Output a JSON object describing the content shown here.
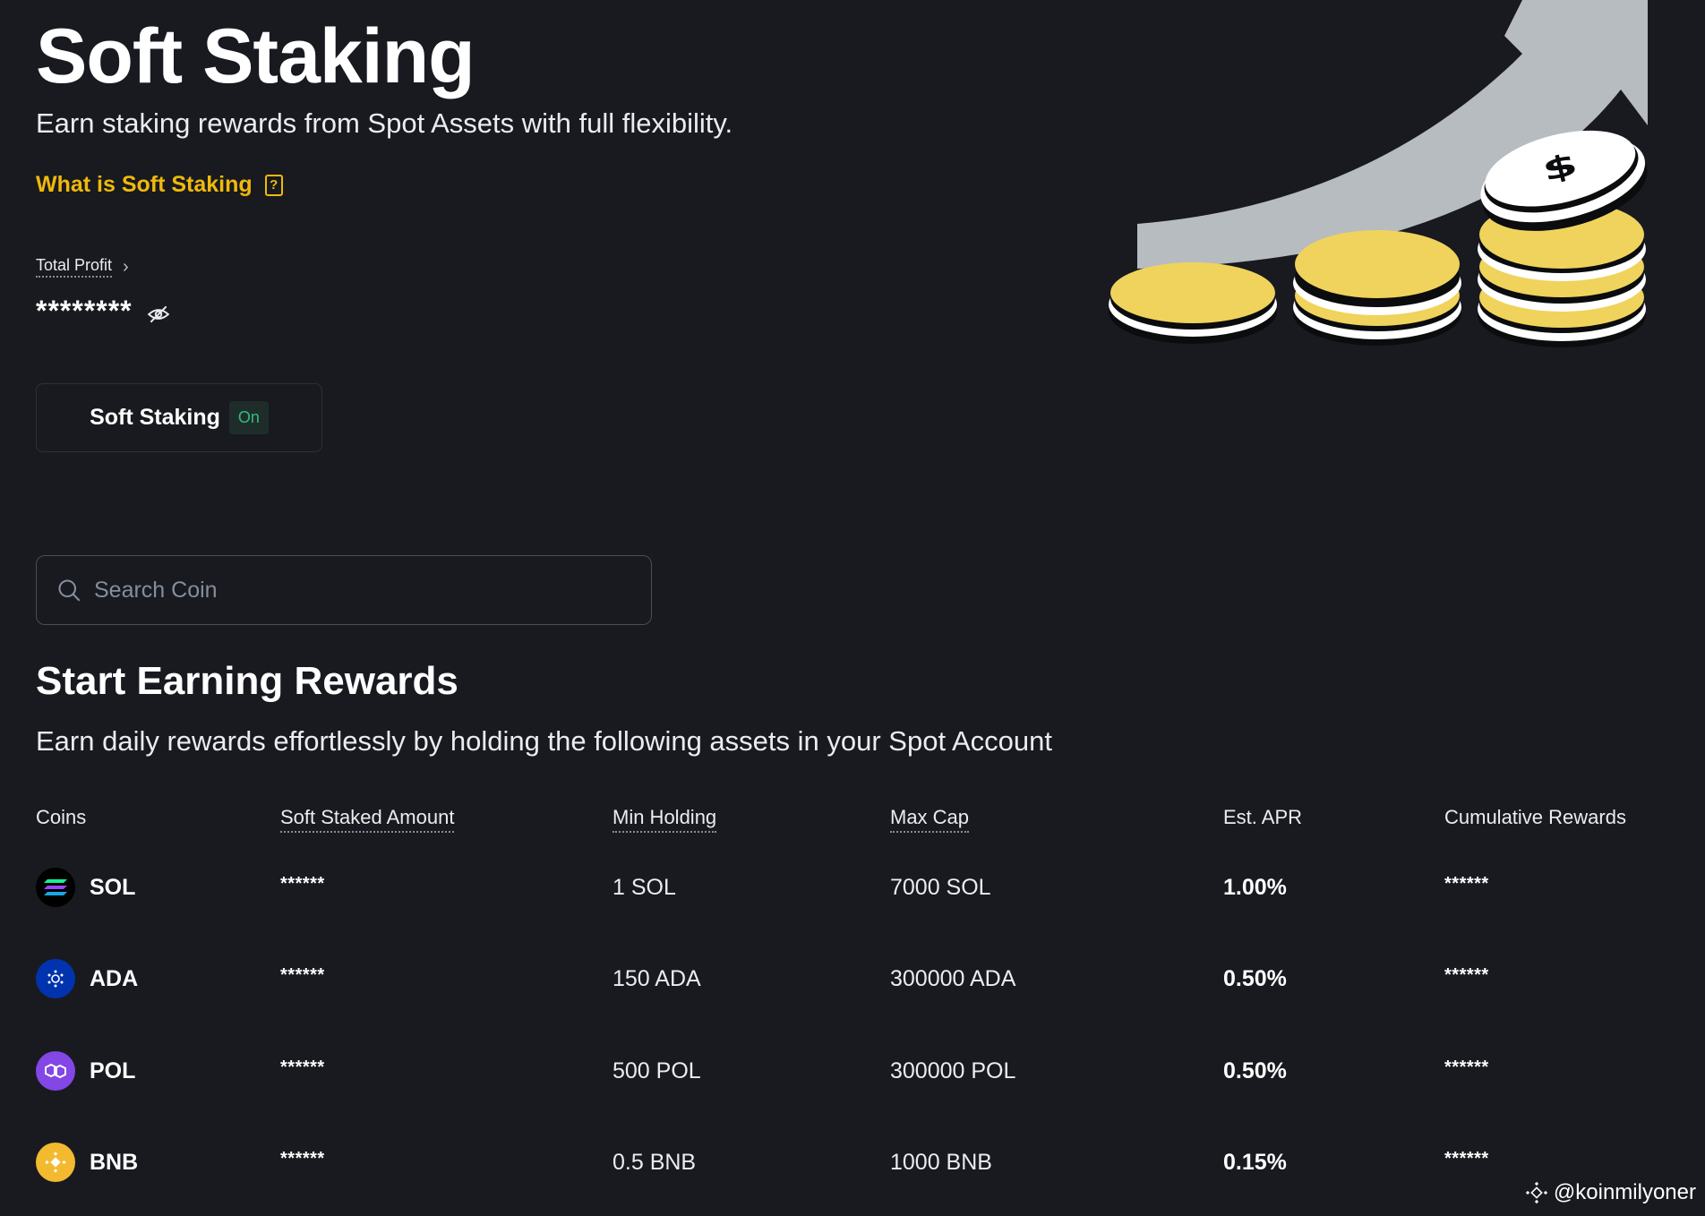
{
  "header": {
    "title": "Soft Staking",
    "subtitle": "Earn staking rewards from Spot Assets with full flexibility.",
    "help_link": "What is Soft Staking",
    "help_icon": "question-book-icon"
  },
  "profit": {
    "label": "Total Profit",
    "value": "********",
    "chevron_icon": "chevron-right-icon",
    "hide_icon": "eye-slash-icon"
  },
  "toggle": {
    "label": "Soft Staking",
    "status": "On"
  },
  "search": {
    "placeholder": "Search Coin",
    "value": "",
    "icon": "search-icon"
  },
  "section": {
    "title": "Start Earning Rewards",
    "subtitle": "Earn daily rewards effortlessly by holding the following assets in your Spot Account"
  },
  "table": {
    "headers": [
      "Coins",
      "Soft Staked Amount",
      "Min Holding",
      "Max Cap",
      "Est. APR",
      "Cumulative Rewards"
    ],
    "rows": [
      {
        "coin": "SOL",
        "staked": "******",
        "min": "1 SOL",
        "max": "7000 SOL",
        "apr": "1.00%",
        "rewards": "******",
        "icon": "solana-icon",
        "color": "#000000"
      },
      {
        "coin": "ADA",
        "staked": "******",
        "min": "150 ADA",
        "max": "300000 ADA",
        "apr": "0.50%",
        "rewards": "******",
        "icon": "cardano-icon",
        "color": "#0033ad"
      },
      {
        "coin": "POL",
        "staked": "******",
        "min": "500 POL",
        "max": "300000 POL",
        "apr": "0.50%",
        "rewards": "******",
        "icon": "polygon-icon",
        "color": "#8247e5"
      },
      {
        "coin": "BNB",
        "staked": "******",
        "min": "0.5 BNB",
        "max": "1000 BNB",
        "apr": "0.15%",
        "rewards": "******",
        "icon": "bnb-icon",
        "color": "#f3ba2f"
      }
    ]
  },
  "watermark": {
    "text": "@koinmilyoner",
    "icon": "binance-square-icon"
  },
  "colors": {
    "background": "#181a20",
    "accent": "#f0b90b",
    "positive": "#2ebd85",
    "coin_yellow": "#f0d35c",
    "arrow_gray": "#b7bcc1"
  }
}
